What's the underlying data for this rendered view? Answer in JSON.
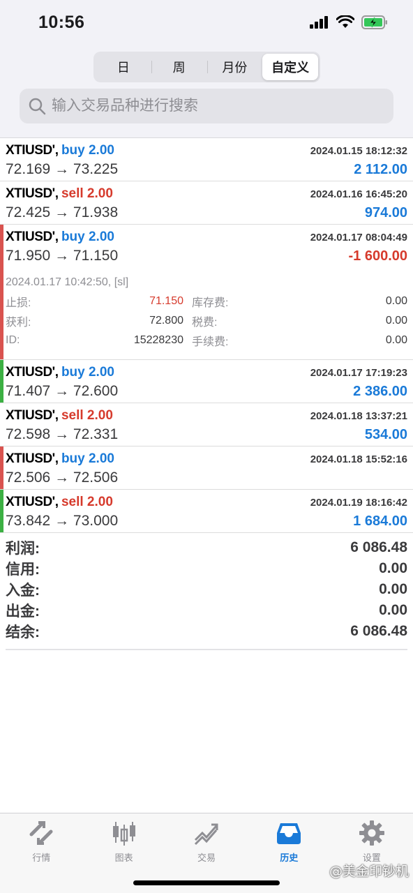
{
  "status_bar": {
    "time": "10:56"
  },
  "period_tabs": [
    {
      "label": "日",
      "active": false
    },
    {
      "label": "周",
      "active": false
    },
    {
      "label": "月份",
      "active": false
    },
    {
      "label": "自定义",
      "active": true
    }
  ],
  "search": {
    "placeholder": "输入交易品种进行搜索"
  },
  "deals": [
    {
      "symbol": "XTIUSD'",
      "separator": ",",
      "side": "buy",
      "volume": "buy 2.00",
      "time": "2024.01.15 18:12:32",
      "prices": "72.169 → 73.225",
      "profit": "2 112.00",
      "profit_sign": "pos",
      "marker": ""
    },
    {
      "symbol": "XTIUSD'",
      "separator": ",",
      "side": "sell",
      "volume": "sell 2.00",
      "time": "2024.01.16 16:45:20",
      "prices": "72.425 → 71.938",
      "profit": "974.00",
      "profit_sign": "pos",
      "marker": ""
    },
    {
      "symbol": "XTIUSD'",
      "separator": ",",
      "side": "buy",
      "volume": "buy 2.00",
      "time": "2024.01.17 08:04:49",
      "prices": "71.950 → 71.150",
      "profit": "-1 600.00",
      "profit_sign": "neg",
      "marker": "#d9534f",
      "details": {
        "close_info": "2024.01.17 10:42:50, [sl]",
        "rows": [
          {
            "label1": "止损:",
            "value1": "71.150",
            "value1_red": true,
            "label2": "库存费:",
            "value2": "0.00"
          },
          {
            "label1": "获利:",
            "value1": "72.800",
            "value1_red": false,
            "label2": "税费:",
            "value2": "0.00"
          },
          {
            "label1": "ID:",
            "value1": "15228230",
            "value1_red": false,
            "label2": "手续费:",
            "value2": "0.00"
          }
        ]
      }
    },
    {
      "symbol": "XTIUSD'",
      "separator": ",",
      "side": "buy",
      "volume": "buy 2.00",
      "time": "2024.01.17 17:19:23",
      "prices": "71.407 → 72.600",
      "profit": "2 386.00",
      "profit_sign": "pos",
      "marker": "#3cb043"
    },
    {
      "symbol": "XTIUSD'",
      "separator": ",",
      "side": "sell",
      "volume": "sell 2.00",
      "time": "2024.01.18 13:37:21",
      "prices": "72.598 → 72.331",
      "profit": "534.00",
      "profit_sign": "pos",
      "marker": ""
    },
    {
      "symbol": "XTIUSD'",
      "separator": ",",
      "side": "buy",
      "volume": "buy 2.00",
      "time": "2024.01.18 15:52:16",
      "prices": "72.506 → 72.506",
      "profit": "",
      "profit_sign": "pos",
      "marker": "#d9534f"
    },
    {
      "symbol": "XTIUSD'",
      "separator": ",",
      "side": "sell",
      "volume": "sell 2.00",
      "time": "2024.01.19 18:16:42",
      "prices": "73.842 → 73.000",
      "profit": "1 684.00",
      "profit_sign": "pos",
      "marker": "#3cb043"
    }
  ],
  "summary": [
    {
      "label": "利润:",
      "value": "6 086.48"
    },
    {
      "label": "信用:",
      "value": "0.00"
    },
    {
      "label": "入金:",
      "value": "0.00"
    },
    {
      "label": "出金:",
      "value": "0.00"
    },
    {
      "label": "结余:",
      "value": "6 086.48"
    }
  ],
  "tabbar": [
    {
      "label": "行情",
      "icon": "quotes-icon",
      "active": false
    },
    {
      "label": "图表",
      "icon": "chart-icon",
      "active": false
    },
    {
      "label": "交易",
      "icon": "trade-icon",
      "active": false
    },
    {
      "label": "历史",
      "icon": "history-icon",
      "active": true
    },
    {
      "label": "设置",
      "icon": "settings-icon",
      "active": false
    }
  ],
  "watermark": "@美金印钞机",
  "colors": {
    "buy": "#1a7ad8",
    "sell": "#d63a2c",
    "accent": "#1a7ad8"
  }
}
